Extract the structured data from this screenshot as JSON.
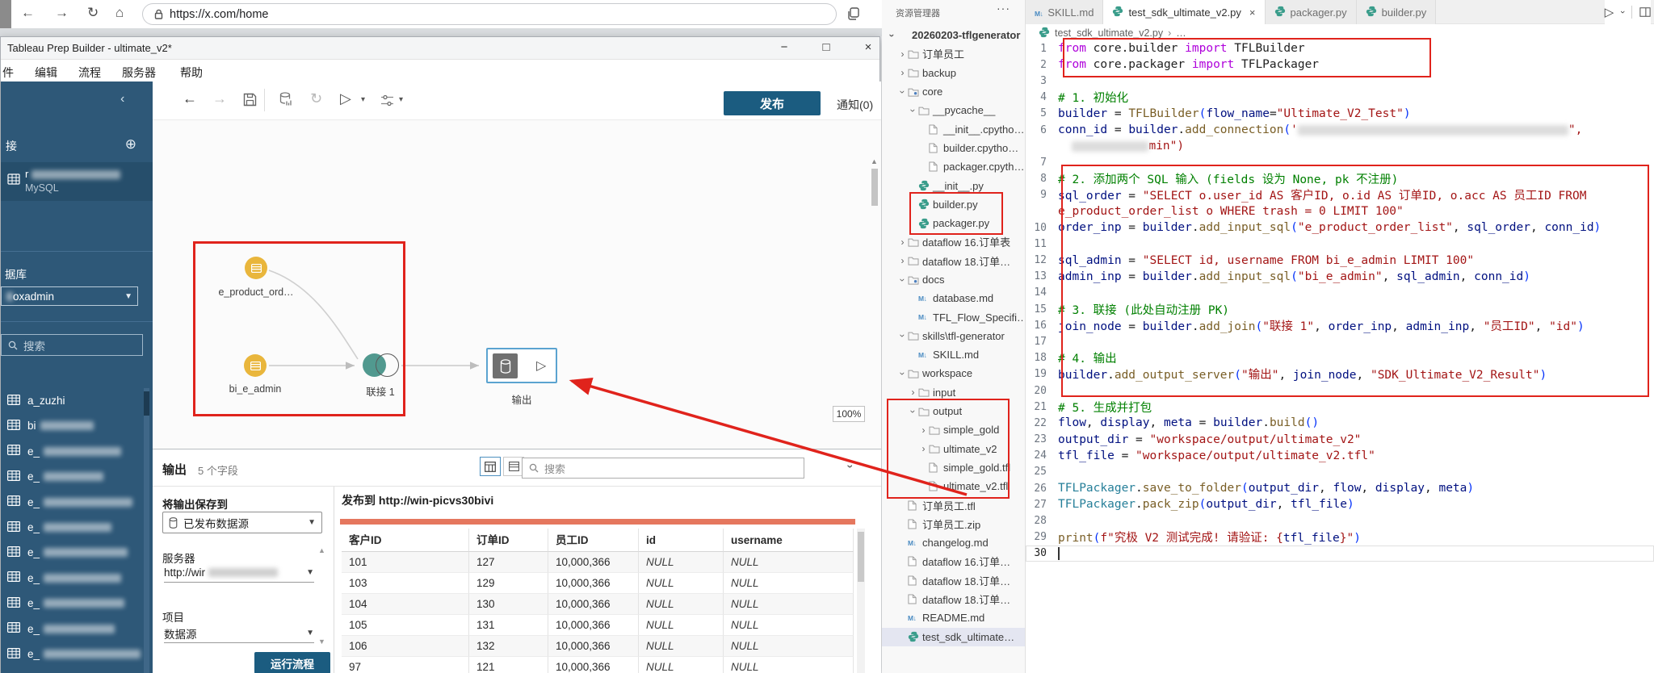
{
  "annotations": {
    "color": "#e0231c"
  },
  "browser": {
    "url": "https://x.com/home"
  },
  "tableau": {
    "title": "Tableau Prep Builder - ultimate_v2*",
    "menu": [
      "件",
      "编辑",
      "流程",
      "服务器",
      "帮助"
    ],
    "window_controls": {
      "minimize": "−",
      "maximize": "□",
      "close": "×"
    },
    "publish_label": "发布",
    "notifications_label": "通知(0)",
    "accent_color": "#1b5c80",
    "sidebar": {
      "collapse_icon": "‹",
      "connections_header": "接",
      "add_icon": "⊕",
      "connection_name_prefix": "r",
      "connection_type": "MySQL",
      "database_label": "据库",
      "database_value": "oxadmin",
      "search_placeholder": "搜索",
      "tables": [
        {
          "label": "a_zuzhi",
          "blur": 0
        },
        {
          "label": "bi",
          "blur": 66
        },
        {
          "label": "e_",
          "blur": 96
        },
        {
          "label": "e_",
          "blur": 74
        },
        {
          "label": "e_",
          "blur": 110
        },
        {
          "label": "e_",
          "blur": 84
        },
        {
          "label": "e_",
          "blur": 104
        },
        {
          "label": "e_",
          "blur": 96
        },
        {
          "label": "e_",
          "blur": 100
        },
        {
          "label": "e_",
          "blur": 88
        },
        {
          "label": "e_",
          "blur": 120
        }
      ]
    },
    "canvas": {
      "nodes": {
        "input1": "e_product_ord…",
        "input2": "bi_e_admin",
        "join": "联接 1",
        "output": "输出"
      },
      "zoom": "100%"
    },
    "output_pane": {
      "title": "输出",
      "fields_count": "5 个字段",
      "search_placeholder": "搜索",
      "save_to_label": "将输出保存到",
      "save_to_value": "已发布数据源",
      "server_label": "服务器",
      "server_value": "http://wir",
      "project_label": "项目",
      "project_value": "数据源",
      "run_button": "运行流程",
      "publish_to_prefix": "发布到",
      "publish_to_url": "http://win-picvs30bivi"
    },
    "preview_table": {
      "columns": [
        "客户ID",
        "订单ID",
        "员工ID",
        "id",
        "username"
      ],
      "rows": [
        [
          "101",
          "127",
          "10,000,366",
          "NULL",
          "NULL"
        ],
        [
          "103",
          "129",
          "10,000,366",
          "NULL",
          "NULL"
        ],
        [
          "104",
          "130",
          "10,000,366",
          "NULL",
          "NULL"
        ],
        [
          "105",
          "131",
          "10,000,366",
          "NULL",
          "NULL"
        ],
        [
          "106",
          "132",
          "10,000,366",
          "NULL",
          "NULL"
        ],
        [
          "97",
          "121",
          "10,000,366",
          "NULL",
          "NULL"
        ]
      ]
    }
  },
  "explorer": {
    "title": "资源管理器",
    "more_icon": "···",
    "items": [
      {
        "l": "20260203-tflgenerator",
        "i": "none",
        "d": 0,
        "t": "open",
        "bold": true
      },
      {
        "l": "订单员工",
        "i": "folder",
        "d": 1,
        "t": "closed"
      },
      {
        "l": "backup",
        "i": "folder",
        "d": 1,
        "t": "closed"
      },
      {
        "l": "core",
        "i": "folder-dot",
        "d": 1,
        "t": "open"
      },
      {
        "l": "__pycache__",
        "i": "folder",
        "d": 2,
        "t": "open"
      },
      {
        "l": "__init__.cpytho…",
        "i": "file",
        "d": 3,
        "t": "none"
      },
      {
        "l": "builder.cpytho…",
        "i": "file",
        "d": 3,
        "t": "none"
      },
      {
        "l": "packager.cpyth…",
        "i": "file",
        "d": 3,
        "t": "none"
      },
      {
        "l": "__init__.py",
        "i": "py",
        "d": 2,
        "t": "none"
      },
      {
        "l": "builder.py",
        "i": "py",
        "d": 2,
        "t": "none"
      },
      {
        "l": "packager.py",
        "i": "py",
        "d": 2,
        "t": "none"
      },
      {
        "l": "dataflow 16.订单表",
        "i": "folder",
        "d": 1,
        "t": "closed"
      },
      {
        "l": "dataflow 18.订单…",
        "i": "folder",
        "d": 1,
        "t": "closed"
      },
      {
        "l": "docs",
        "i": "folder-dot",
        "d": 1,
        "t": "open"
      },
      {
        "l": "database.md",
        "i": "md",
        "d": 2,
        "t": "none"
      },
      {
        "l": "TFL_Flow_Specifi…",
        "i": "md",
        "d": 2,
        "t": "none"
      },
      {
        "l": "skills\\tfl-generator",
        "i": "folder",
        "d": 1,
        "t": "open"
      },
      {
        "l": "SKILL.md",
        "i": "md",
        "d": 2,
        "t": "none"
      },
      {
        "l": "workspace",
        "i": "folder",
        "d": 1,
        "t": "open"
      },
      {
        "l": "input",
        "i": "folder",
        "d": 2,
        "t": "closed"
      },
      {
        "l": "output",
        "i": "folder",
        "d": 2,
        "t": "open"
      },
      {
        "l": "simple_gold",
        "i": "folder",
        "d": 3,
        "t": "closed"
      },
      {
        "l": "ultimate_v2",
        "i": "folder",
        "d": 3,
        "t": "closed"
      },
      {
        "l": "simple_gold.tfl",
        "i": "file",
        "d": 3,
        "t": "none"
      },
      {
        "l": "ultimate_v2.tfl",
        "i": "file",
        "d": 3,
        "t": "none"
      },
      {
        "l": "订单员工.tfl",
        "i": "file",
        "d": 1,
        "t": "none"
      },
      {
        "l": "订单员工.zip",
        "i": "file",
        "d": 1,
        "t": "none"
      },
      {
        "l": "changelog.md",
        "i": "md",
        "d": 1,
        "t": "none"
      },
      {
        "l": "dataflow 16.订单…",
        "i": "file",
        "d": 1,
        "t": "none"
      },
      {
        "l": "dataflow 18.订单…",
        "i": "file",
        "d": 1,
        "t": "none"
      },
      {
        "l": "dataflow 18.订单…",
        "i": "file",
        "d": 1,
        "t": "none"
      },
      {
        "l": "README.md",
        "i": "md",
        "d": 1,
        "t": "none"
      },
      {
        "l": "test_sdk_ultimate…",
        "i": "py",
        "d": 1,
        "t": "none",
        "sel": true
      }
    ]
  },
  "editor": {
    "tabs": [
      {
        "label": "SKILL.md",
        "icon": "md",
        "active": false
      },
      {
        "label": "test_sdk_ultimate_v2.py",
        "icon": "py",
        "active": true,
        "close": "×"
      },
      {
        "label": "packager.py",
        "icon": "py",
        "active": false
      },
      {
        "label": "builder.py",
        "icon": "py",
        "active": false
      }
    ],
    "breadcrumb": {
      "file": "test_sdk_ultimate_v2.py",
      "sep": "›",
      "more": "…"
    },
    "code": {
      "lines": [
        {
          "n": 1,
          "t": [
            [
              "k",
              "from"
            ],
            [
              "d",
              " core.builder "
            ],
            [
              "k",
              "import"
            ],
            [
              "d",
              " TFLBuilder"
            ]
          ]
        },
        {
          "n": 2,
          "t": [
            [
              "k",
              "from"
            ],
            [
              "d",
              " core.packager "
            ],
            [
              "k",
              "import"
            ],
            [
              "d",
              " TFLPackager"
            ]
          ]
        },
        {
          "n": 3,
          "t": []
        },
        {
          "n": 4,
          "t": [
            [
              "c",
              "# 1. 初始化"
            ]
          ]
        },
        {
          "n": 5,
          "t": [
            [
              "v",
              "builder"
            ],
            [
              "d",
              " = "
            ],
            [
              "f",
              "TFLBuilder"
            ],
            [
              "p",
              "("
            ],
            [
              "v",
              "flow_name"
            ],
            [
              "d",
              "="
            ],
            [
              "s",
              "\"Ultimate_V2_Test\""
            ],
            [
              "p",
              ")"
            ]
          ]
        },
        {
          "n": 6,
          "t": [
            [
              "v",
              "conn_id"
            ],
            [
              "d",
              " = "
            ],
            [
              "v",
              "builder"
            ],
            [
              "d",
              "."
            ],
            [
              "f",
              "add_connection"
            ],
            [
              "p",
              "("
            ],
            [
              "s",
              "'"
            ],
            [
              "b",
              "335"
            ],
            [
              "s",
              "\","
            ]
          ],
          "w": [
            [
              "d",
              "  "
            ],
            [
              "b",
              "95"
            ],
            [
              "s",
              "min\")"
            ]
          ]
        },
        {
          "n": 7,
          "t": []
        },
        {
          "n": 8,
          "t": [
            [
              "c",
              "# 2. 添加两个 SQL 输入 (fields 设为 None, pk 不注册)"
            ]
          ]
        },
        {
          "n": 9,
          "t": [
            [
              "v",
              "sql_order"
            ],
            [
              "d",
              " = "
            ],
            [
              "s",
              "\"SELECT o.user_id AS 客户ID, o.id AS 订单ID, o.acc AS 员工ID FROM"
            ]
          ],
          "w": [
            [
              "s",
              "e_product_order_list o WHERE trash = 0 LIMIT 100\""
            ]
          ]
        },
        {
          "n": 10,
          "t": [
            [
              "v",
              "order_inp"
            ],
            [
              "d",
              " = "
            ],
            [
              "v",
              "builder"
            ],
            [
              "d",
              "."
            ],
            [
              "f",
              "add_input_sql"
            ],
            [
              "p",
              "("
            ],
            [
              "s",
              "\"e_product_order_list\""
            ],
            [
              "d",
              ", "
            ],
            [
              "v",
              "sql_order"
            ],
            [
              "d",
              ", "
            ],
            [
              "v",
              "conn_id"
            ],
            [
              "p",
              ")"
            ]
          ]
        },
        {
          "n": 11,
          "t": []
        },
        {
          "n": 12,
          "t": [
            [
              "v",
              "sql_admin"
            ],
            [
              "d",
              " = "
            ],
            [
              "s",
              "\"SELECT id, username FROM bi_e_admin LIMIT 100\""
            ]
          ]
        },
        {
          "n": 13,
          "t": [
            [
              "v",
              "admin_inp"
            ],
            [
              "d",
              " = "
            ],
            [
              "v",
              "builder"
            ],
            [
              "d",
              "."
            ],
            [
              "f",
              "add_input_sql"
            ],
            [
              "p",
              "("
            ],
            [
              "s",
              "\"bi_e_admin\""
            ],
            [
              "d",
              ", "
            ],
            [
              "v",
              "sql_admin"
            ],
            [
              "d",
              ", "
            ],
            [
              "v",
              "conn_id"
            ],
            [
              "p",
              ")"
            ]
          ]
        },
        {
          "n": 14,
          "t": []
        },
        {
          "n": 15,
          "t": [
            [
              "c",
              "# 3. 联接 (此处自动注册 PK)"
            ]
          ]
        },
        {
          "n": 16,
          "t": [
            [
              "v",
              "join_node"
            ],
            [
              "d",
              " = "
            ],
            [
              "v",
              "builder"
            ],
            [
              "d",
              "."
            ],
            [
              "f",
              "add_join"
            ],
            [
              "p",
              "("
            ],
            [
              "s",
              "\"联接 1\""
            ],
            [
              "d",
              ", "
            ],
            [
              "v",
              "order_inp"
            ],
            [
              "d",
              ", "
            ],
            [
              "v",
              "admin_inp"
            ],
            [
              "d",
              ", "
            ],
            [
              "s",
              "\"员工ID\""
            ],
            [
              "d",
              ", "
            ],
            [
              "s",
              "\"id\""
            ],
            [
              "p",
              ")"
            ]
          ]
        },
        {
          "n": 17,
          "t": []
        },
        {
          "n": 18,
          "t": [
            [
              "c",
              "# 4. 输出"
            ]
          ]
        },
        {
          "n": 19,
          "t": [
            [
              "v",
              "builder"
            ],
            [
              "d",
              "."
            ],
            [
              "f",
              "add_output_server"
            ],
            [
              "p",
              "("
            ],
            [
              "s",
              "\"输出\""
            ],
            [
              "d",
              ", "
            ],
            [
              "v",
              "join_node"
            ],
            [
              "d",
              ", "
            ],
            [
              "s",
              "\"SDK_Ultimate_V2_Result\""
            ],
            [
              "p",
              ")"
            ]
          ]
        },
        {
          "n": 20,
          "t": []
        },
        {
          "n": 21,
          "t": [
            [
              "c",
              "# 5. 生成并打包"
            ]
          ]
        },
        {
          "n": 22,
          "t": [
            [
              "v",
              "flow"
            ],
            [
              "d",
              ", "
            ],
            [
              "v",
              "display"
            ],
            [
              "d",
              ", "
            ],
            [
              "v",
              "meta"
            ],
            [
              "d",
              " = "
            ],
            [
              "v",
              "builder"
            ],
            [
              "d",
              "."
            ],
            [
              "f",
              "build"
            ],
            [
              "p",
              "()"
            ]
          ]
        },
        {
          "n": 23,
          "t": [
            [
              "v",
              "output_dir"
            ],
            [
              "d",
              " = "
            ],
            [
              "s",
              "\"workspace/output/ultimate_v2\""
            ]
          ]
        },
        {
          "n": 24,
          "t": [
            [
              "v",
              "tfl_file"
            ],
            [
              "d",
              " = "
            ],
            [
              "s",
              "\"workspace/output/ultimate_v2.tfl\""
            ]
          ]
        },
        {
          "n": 25,
          "t": []
        },
        {
          "n": 26,
          "t": [
            [
              "cls",
              "TFLPackager"
            ],
            [
              "d",
              "."
            ],
            [
              "f",
              "save_to_folder"
            ],
            [
              "p",
              "("
            ],
            [
              "v",
              "output_dir"
            ],
            [
              "d",
              ", "
            ],
            [
              "v",
              "flow"
            ],
            [
              "d",
              ", "
            ],
            [
              "v",
              "display"
            ],
            [
              "d",
              ", "
            ],
            [
              "v",
              "meta"
            ],
            [
              "p",
              ")"
            ]
          ]
        },
        {
          "n": 27,
          "t": [
            [
              "cls",
              "TFLPackager"
            ],
            [
              "d",
              "."
            ],
            [
              "f",
              "pack_zip"
            ],
            [
              "p",
              "("
            ],
            [
              "v",
              "output_dir"
            ],
            [
              "d",
              ", "
            ],
            [
              "v",
              "tfl_file"
            ],
            [
              "p",
              ")"
            ]
          ]
        },
        {
          "n": 28,
          "t": []
        },
        {
          "n": 29,
          "t": [
            [
              "f",
              "print"
            ],
            [
              "p",
              "("
            ],
            [
              "s",
              "f\"究极 V2 测试完成! 请验证: {"
            ],
            [
              "v",
              "tfl_file"
            ],
            [
              "s",
              "}\""
            ],
            [
              "p",
              ")"
            ]
          ]
        },
        {
          "n": 30,
          "t": [],
          "cur": true
        }
      ]
    }
  }
}
